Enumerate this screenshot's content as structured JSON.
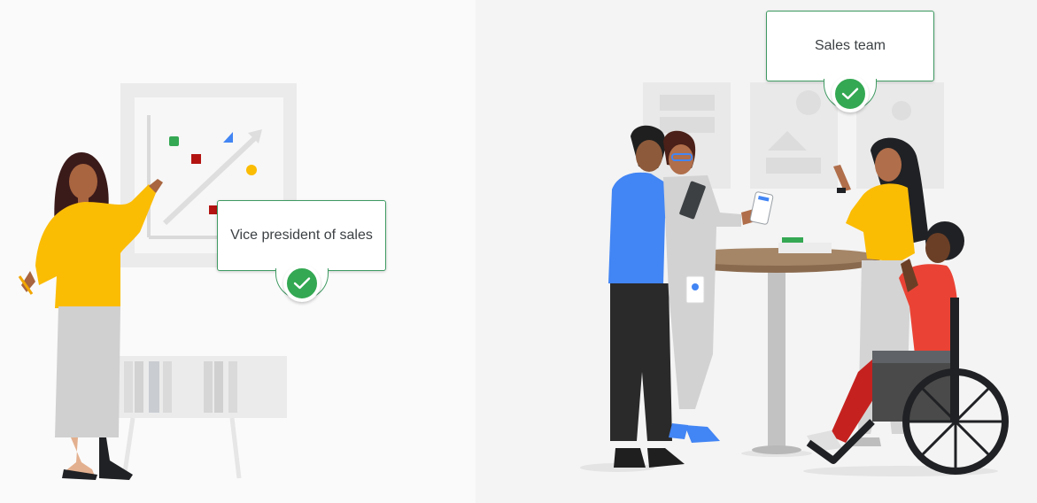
{
  "left_card": {
    "label": "Vice president of sales"
  },
  "right_card": {
    "label": "Sales team"
  },
  "icons": {
    "check": "checkmark-icon"
  },
  "colors": {
    "accent_green": "#34a853",
    "card_border": "#3f9a62",
    "yellow": "#fbbc04",
    "blue": "#4285f4",
    "red": "#ea4335"
  }
}
